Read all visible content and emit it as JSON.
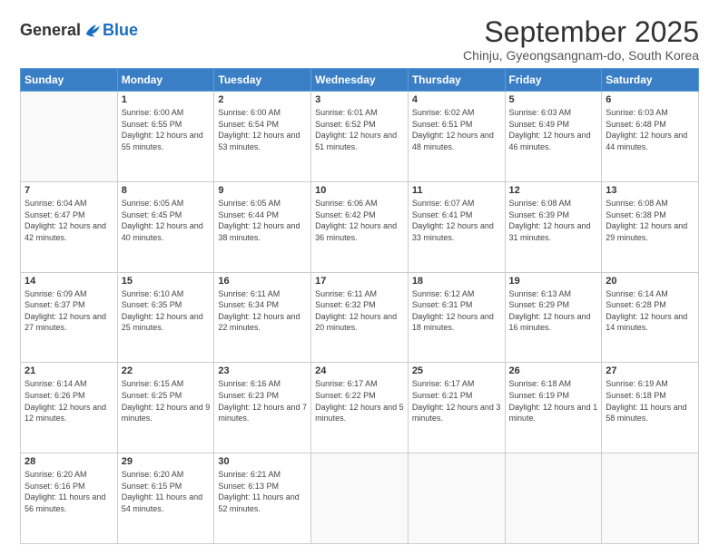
{
  "logo": {
    "general": "General",
    "blue": "Blue"
  },
  "title": "September 2025",
  "subtitle": "Chinju, Gyeongsangnam-do, South Korea",
  "headers": [
    "Sunday",
    "Monday",
    "Tuesday",
    "Wednesday",
    "Thursday",
    "Friday",
    "Saturday"
  ],
  "weeks": [
    [
      {
        "day": "",
        "sunrise": "",
        "sunset": "",
        "daylight": ""
      },
      {
        "day": "1",
        "sunrise": "Sunrise: 6:00 AM",
        "sunset": "Sunset: 6:55 PM",
        "daylight": "Daylight: 12 hours and 55 minutes."
      },
      {
        "day": "2",
        "sunrise": "Sunrise: 6:00 AM",
        "sunset": "Sunset: 6:54 PM",
        "daylight": "Daylight: 12 hours and 53 minutes."
      },
      {
        "day": "3",
        "sunrise": "Sunrise: 6:01 AM",
        "sunset": "Sunset: 6:52 PM",
        "daylight": "Daylight: 12 hours and 51 minutes."
      },
      {
        "day": "4",
        "sunrise": "Sunrise: 6:02 AM",
        "sunset": "Sunset: 6:51 PM",
        "daylight": "Daylight: 12 hours and 48 minutes."
      },
      {
        "day": "5",
        "sunrise": "Sunrise: 6:03 AM",
        "sunset": "Sunset: 6:49 PM",
        "daylight": "Daylight: 12 hours and 46 minutes."
      },
      {
        "day": "6",
        "sunrise": "Sunrise: 6:03 AM",
        "sunset": "Sunset: 6:48 PM",
        "daylight": "Daylight: 12 hours and 44 minutes."
      }
    ],
    [
      {
        "day": "7",
        "sunrise": "Sunrise: 6:04 AM",
        "sunset": "Sunset: 6:47 PM",
        "daylight": "Daylight: 12 hours and 42 minutes."
      },
      {
        "day": "8",
        "sunrise": "Sunrise: 6:05 AM",
        "sunset": "Sunset: 6:45 PM",
        "daylight": "Daylight: 12 hours and 40 minutes."
      },
      {
        "day": "9",
        "sunrise": "Sunrise: 6:05 AM",
        "sunset": "Sunset: 6:44 PM",
        "daylight": "Daylight: 12 hours and 38 minutes."
      },
      {
        "day": "10",
        "sunrise": "Sunrise: 6:06 AM",
        "sunset": "Sunset: 6:42 PM",
        "daylight": "Daylight: 12 hours and 36 minutes."
      },
      {
        "day": "11",
        "sunrise": "Sunrise: 6:07 AM",
        "sunset": "Sunset: 6:41 PM",
        "daylight": "Daylight: 12 hours and 33 minutes."
      },
      {
        "day": "12",
        "sunrise": "Sunrise: 6:08 AM",
        "sunset": "Sunset: 6:39 PM",
        "daylight": "Daylight: 12 hours and 31 minutes."
      },
      {
        "day": "13",
        "sunrise": "Sunrise: 6:08 AM",
        "sunset": "Sunset: 6:38 PM",
        "daylight": "Daylight: 12 hours and 29 minutes."
      }
    ],
    [
      {
        "day": "14",
        "sunrise": "Sunrise: 6:09 AM",
        "sunset": "Sunset: 6:37 PM",
        "daylight": "Daylight: 12 hours and 27 minutes."
      },
      {
        "day": "15",
        "sunrise": "Sunrise: 6:10 AM",
        "sunset": "Sunset: 6:35 PM",
        "daylight": "Daylight: 12 hours and 25 minutes."
      },
      {
        "day": "16",
        "sunrise": "Sunrise: 6:11 AM",
        "sunset": "Sunset: 6:34 PM",
        "daylight": "Daylight: 12 hours and 22 minutes."
      },
      {
        "day": "17",
        "sunrise": "Sunrise: 6:11 AM",
        "sunset": "Sunset: 6:32 PM",
        "daylight": "Daylight: 12 hours and 20 minutes."
      },
      {
        "day": "18",
        "sunrise": "Sunrise: 6:12 AM",
        "sunset": "Sunset: 6:31 PM",
        "daylight": "Daylight: 12 hours and 18 minutes."
      },
      {
        "day": "19",
        "sunrise": "Sunrise: 6:13 AM",
        "sunset": "Sunset: 6:29 PM",
        "daylight": "Daylight: 12 hours and 16 minutes."
      },
      {
        "day": "20",
        "sunrise": "Sunrise: 6:14 AM",
        "sunset": "Sunset: 6:28 PM",
        "daylight": "Daylight: 12 hours and 14 minutes."
      }
    ],
    [
      {
        "day": "21",
        "sunrise": "Sunrise: 6:14 AM",
        "sunset": "Sunset: 6:26 PM",
        "daylight": "Daylight: 12 hours and 12 minutes."
      },
      {
        "day": "22",
        "sunrise": "Sunrise: 6:15 AM",
        "sunset": "Sunset: 6:25 PM",
        "daylight": "Daylight: 12 hours and 9 minutes."
      },
      {
        "day": "23",
        "sunrise": "Sunrise: 6:16 AM",
        "sunset": "Sunset: 6:23 PM",
        "daylight": "Daylight: 12 hours and 7 minutes."
      },
      {
        "day": "24",
        "sunrise": "Sunrise: 6:17 AM",
        "sunset": "Sunset: 6:22 PM",
        "daylight": "Daylight: 12 hours and 5 minutes."
      },
      {
        "day": "25",
        "sunrise": "Sunrise: 6:17 AM",
        "sunset": "Sunset: 6:21 PM",
        "daylight": "Daylight: 12 hours and 3 minutes."
      },
      {
        "day": "26",
        "sunrise": "Sunrise: 6:18 AM",
        "sunset": "Sunset: 6:19 PM",
        "daylight": "Daylight: 12 hours and 1 minute."
      },
      {
        "day": "27",
        "sunrise": "Sunrise: 6:19 AM",
        "sunset": "Sunset: 6:18 PM",
        "daylight": "Daylight: 11 hours and 58 minutes."
      }
    ],
    [
      {
        "day": "28",
        "sunrise": "Sunrise: 6:20 AM",
        "sunset": "Sunset: 6:16 PM",
        "daylight": "Daylight: 11 hours and 56 minutes."
      },
      {
        "day": "29",
        "sunrise": "Sunrise: 6:20 AM",
        "sunset": "Sunset: 6:15 PM",
        "daylight": "Daylight: 11 hours and 54 minutes."
      },
      {
        "day": "30",
        "sunrise": "Sunrise: 6:21 AM",
        "sunset": "Sunset: 6:13 PM",
        "daylight": "Daylight: 11 hours and 52 minutes."
      },
      {
        "day": "",
        "sunrise": "",
        "sunset": "",
        "daylight": ""
      },
      {
        "day": "",
        "sunrise": "",
        "sunset": "",
        "daylight": ""
      },
      {
        "day": "",
        "sunrise": "",
        "sunset": "",
        "daylight": ""
      },
      {
        "day": "",
        "sunrise": "",
        "sunset": "",
        "daylight": ""
      }
    ]
  ]
}
